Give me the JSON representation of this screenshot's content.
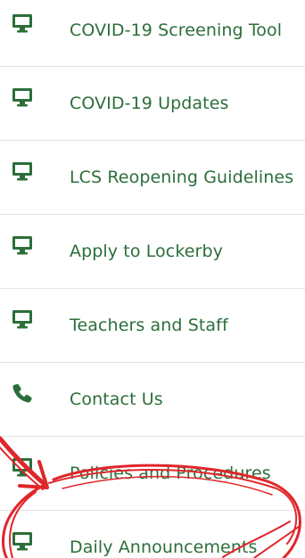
{
  "accent_color": "#2c6e3a",
  "annotation_color": "#e0262b",
  "menu": {
    "items": [
      {
        "label": "COVID-19 Screening Tool",
        "icon": "monitor-icon"
      },
      {
        "label": "COVID-19 Updates",
        "icon": "monitor-icon"
      },
      {
        "label": "LCS Reopening Guidelines",
        "icon": "monitor-icon"
      },
      {
        "label": "Apply to Lockerby",
        "icon": "monitor-icon"
      },
      {
        "label": "Teachers and Staff",
        "icon": "monitor-icon"
      },
      {
        "label": "Contact Us",
        "icon": "phone-icon"
      },
      {
        "label": "Policies and Procedures",
        "icon": "monitor-icon"
      },
      {
        "label": "Daily Announcements",
        "icon": "monitor-icon"
      }
    ]
  }
}
